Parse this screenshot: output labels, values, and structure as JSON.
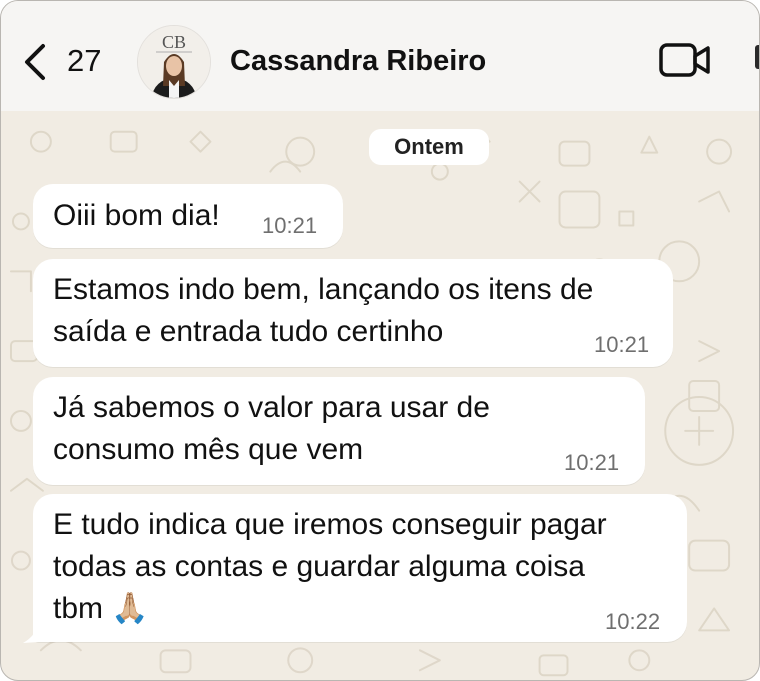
{
  "header": {
    "back_count": "27",
    "avatar_monogram": "CB",
    "contact_name": "Cassandra Ribeiro",
    "back_icon": "chevron-left-icon",
    "call_icon": "video-camera-icon"
  },
  "chat": {
    "date_divider": "Ontem",
    "messages": [
      {
        "lines": [
          "Oiii bom dia!"
        ],
        "time": "10:21"
      },
      {
        "lines": [
          "Estamos indo bem, lançando os itens de",
          "saída e entrada tudo certinho"
        ],
        "time": "10:21"
      },
      {
        "lines": [
          "Já sabemos o valor para usar de",
          "consumo mês que vem"
        ],
        "time": "10:21"
      },
      {
        "lines": [
          "E tudo indica que iremos conseguir pagar",
          "todas as contas e guardar alguma coisa",
          "tbm 🙏🏼"
        ],
        "time": "10:22"
      }
    ]
  },
  "colors": {
    "chat_background": "#f1ece3",
    "header_background": "#f6f5f3",
    "bubble": "#ffffff"
  }
}
